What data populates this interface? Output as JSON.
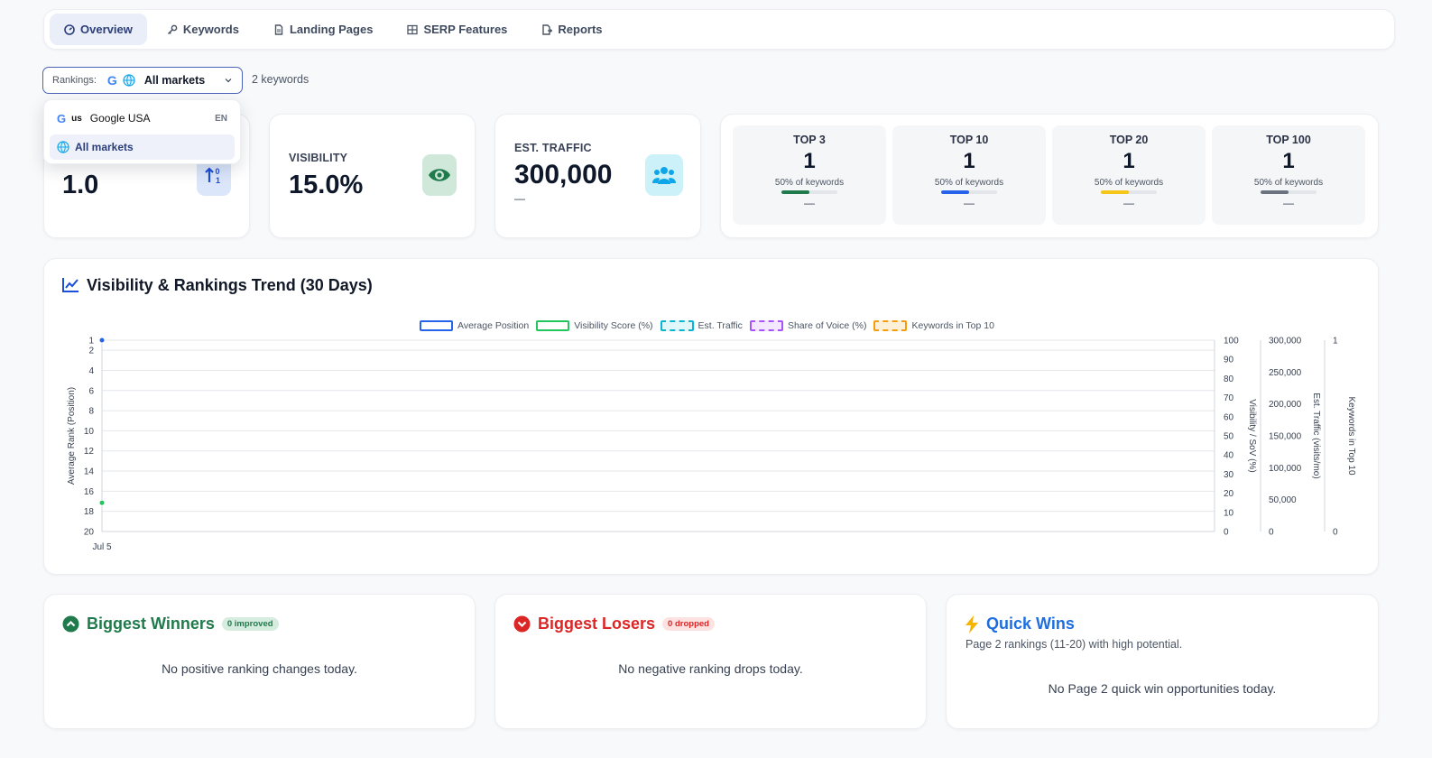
{
  "nav": {
    "tabs": [
      {
        "label": "Overview",
        "icon": "gauge-icon",
        "active": true
      },
      {
        "label": "Keywords",
        "icon": "key-icon"
      },
      {
        "label": "Landing Pages",
        "icon": "file-icon"
      },
      {
        "label": "SERP Features",
        "icon": "grid-icon"
      },
      {
        "label": "Reports",
        "icon": "report-icon"
      }
    ]
  },
  "filter": {
    "label": "Rankings:",
    "value": "All markets",
    "keyword_count": "2 keywords",
    "options": [
      {
        "code": "us",
        "label": "Google USA",
        "lang": "EN"
      },
      {
        "label": "All markets",
        "selected": true
      }
    ]
  },
  "kpis": {
    "avg_position": {
      "value": "1.0"
    },
    "visibility": {
      "label": "VISIBILITY",
      "value": "15.0%"
    },
    "traffic": {
      "label": "EST. TRAFFIC",
      "value": "300,000",
      "delta": "—"
    }
  },
  "tiers": [
    {
      "name": "TOP 3",
      "value": "1",
      "sub": "50% of keywords",
      "pct": 0.5,
      "color": "#1f7a4c",
      "delta": "—"
    },
    {
      "name": "TOP 10",
      "value": "1",
      "sub": "50% of keywords",
      "pct": 0.5,
      "color": "#2563eb",
      "delta": "—"
    },
    {
      "name": "TOP 20",
      "value": "1",
      "sub": "50% of keywords",
      "pct": 0.5,
      "color": "#f5c518",
      "delta": "—"
    },
    {
      "name": "TOP 100",
      "value": "1",
      "sub": "50% of keywords",
      "pct": 0.5,
      "color": "#6b7280",
      "delta": "—"
    }
  ],
  "trend": {
    "title": "Visibility & Rankings Trend (30 Days)",
    "legend": [
      {
        "label": "Average Position",
        "color": "#2563eb",
        "dashed": false,
        "fill": "#ffffff"
      },
      {
        "label": "Visibility Score (%)",
        "color": "#22c55e",
        "dashed": false,
        "fill": "#ffffff"
      },
      {
        "label": "Est. Traffic",
        "color": "#06b6d4",
        "dashed": true,
        "fill": "#e0f7fb"
      },
      {
        "label": "Share of Voice (%)",
        "color": "#a855f7",
        "dashed": true,
        "fill": "#f3e8ff"
      },
      {
        "label": "Keywords in Top 10",
        "color": "#f59e0b",
        "dashed": true,
        "fill": "#fdf0d8"
      }
    ]
  },
  "chart_data": {
    "type": "line",
    "x": [
      "Jul 5"
    ],
    "series": [
      {
        "name": "Average Position",
        "values": [
          1
        ],
        "axis": "left",
        "color": "#2563eb"
      },
      {
        "name": "Visibility Score (%)",
        "values": [
          15
        ],
        "axis": "right1",
        "color": "#22c55e"
      }
    ],
    "axes": {
      "left": {
        "title": "Average Rank (Position)",
        "ticks": [
          "1",
          "2",
          "4",
          "6",
          "8",
          "10",
          "12",
          "14",
          "16",
          "18",
          "20"
        ],
        "range": [
          1,
          20
        ],
        "reversed": true
      },
      "right1": {
        "title": "Visibility / SoV (%)",
        "ticks": [
          "100",
          "90",
          "80",
          "70",
          "60",
          "50",
          "40",
          "30",
          "20",
          "10",
          "0"
        ],
        "range": [
          0,
          100
        ]
      },
      "right2": {
        "title": "Est. Traffic (visits/mo)",
        "ticks": [
          "300,000",
          "250,000",
          "200,000",
          "150,000",
          "100,000",
          "50,000",
          "0"
        ],
        "range": [
          0,
          300000
        ]
      },
      "right3": {
        "title": "Keywords in Top 10",
        "ticks": [
          "1",
          "0"
        ],
        "range": [
          0,
          1
        ]
      }
    },
    "grid": true
  },
  "winners": {
    "title": "Biggest Winners",
    "badge": "0 improved",
    "empty": "No positive ranking changes today."
  },
  "losers": {
    "title": "Biggest Losers",
    "badge": "0 dropped",
    "empty": "No negative ranking drops today."
  },
  "quickwins": {
    "title": "Quick Wins",
    "subtitle": "Page 2 rankings (11-20) with high potential.",
    "empty": "No Page 2 quick win opportunities today."
  }
}
